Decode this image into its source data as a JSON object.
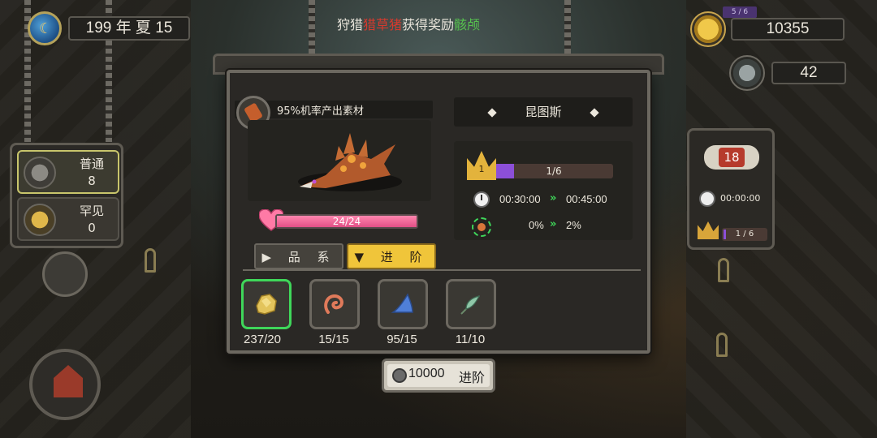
{
  "hud": {
    "date": "199 年 夏 15",
    "notice_prefix": "狩猎",
    "notice_red": "猎草猪",
    "notice_mid": "获得奖励",
    "notice_green": "骸颅",
    "coins": "10355",
    "resource": "42",
    "badge": "5 / 6"
  },
  "rarity_panel": {
    "items": [
      {
        "label": "普通",
        "count": "8"
      },
      {
        "label": "罕见",
        "count": "0"
      }
    ]
  },
  "mini_panel": {
    "badge": "18",
    "time": "00:00:00",
    "level": "1",
    "progress": "1 / 6"
  },
  "dialog": {
    "material_text": "95%机率产出素材",
    "hp_text": "24/24",
    "hp_fraction": 1.0,
    "tabs": {
      "pinxi": "品 系",
      "jinjie": "进 阶"
    },
    "name": "昆图斯",
    "level": "1",
    "level_text": "1/6",
    "level_fraction": 0.1667,
    "time_from": "00:30:00",
    "time_to": "00:45:00",
    "rate_from": "0%",
    "rate_to": "2%",
    "materials": [
      {
        "count": "237/20",
        "icon": "gold-nugget-icon",
        "color": "#e3c45c"
      },
      {
        "count": "15/15",
        "icon": "worm-icon",
        "color": "#e07a5a"
      },
      {
        "count": "95/15",
        "icon": "blue-feather-icon",
        "color": "#4f7fd8"
      },
      {
        "count": "11/10",
        "icon": "green-herb-icon",
        "color": "#8fc7a8"
      }
    ]
  },
  "button": {
    "amount": "10000",
    "label": "进阶"
  }
}
